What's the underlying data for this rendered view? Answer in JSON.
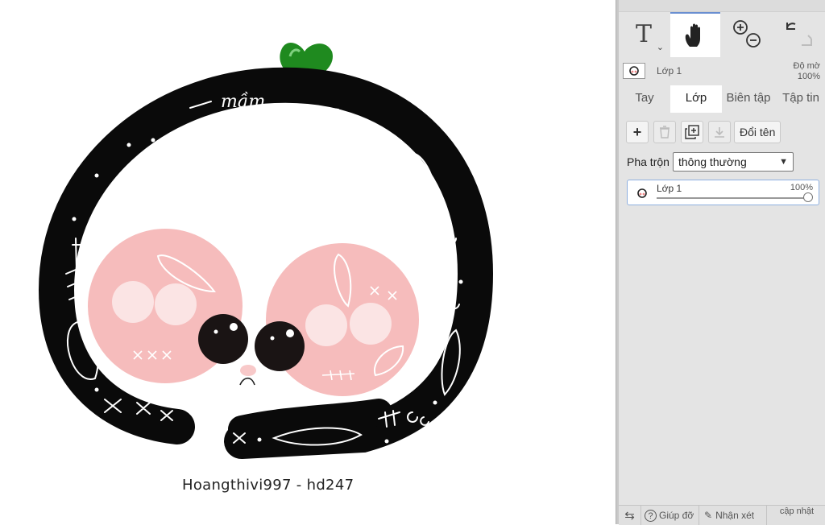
{
  "canvas": {
    "signature": "Hoangthivi997 - hd247",
    "artwork_label": "mầm",
    "colors": {
      "frame": "#0a0a0a",
      "cheek": "#f6bcbc",
      "leaf": "#1f8a1f",
      "background": "#ffffff"
    }
  },
  "toolbar": {
    "text_tool_glyph": "T",
    "tools": [
      {
        "name": "text-tool",
        "icon": "text-icon"
      },
      {
        "name": "hand-tool",
        "icon": "hand-icon",
        "active": true
      },
      {
        "name": "zoom-tool",
        "icon": "zoom-in-out-icon"
      },
      {
        "name": "undo-redo",
        "icon": "undo-redo-icon"
      }
    ]
  },
  "layer_header": {
    "name": "Lớp 1",
    "opacity_label": "Độ mờ",
    "opacity_value": "100%"
  },
  "tabs": [
    {
      "label": "Tay",
      "active": false
    },
    {
      "label": "Lớp",
      "active": true
    },
    {
      "label": "Biên tập",
      "active": false
    },
    {
      "label": "Tập tin",
      "active": false
    }
  ],
  "layer_actions": {
    "add": "+",
    "rename": "Đổi tên"
  },
  "blend": {
    "label": "Pha trộn",
    "selected": "thông thường"
  },
  "layers": [
    {
      "name": "Lớp 1",
      "opacity": "100%"
    }
  ],
  "footer": {
    "help": "Giúp đỡ",
    "comment": "Nhận xét",
    "update": "cập nhật"
  }
}
